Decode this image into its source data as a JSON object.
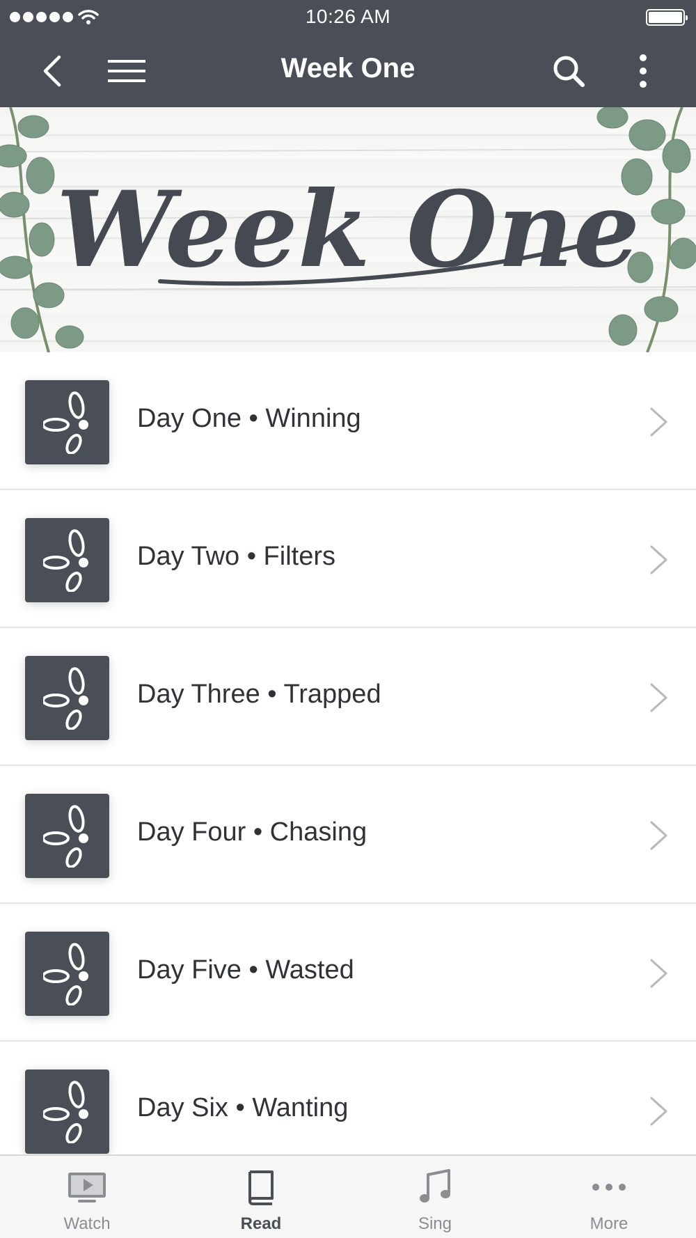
{
  "status_bar": {
    "time": "10:26 AM",
    "signal_icon": "signal-dots-icon",
    "wifi_icon": "wifi-icon",
    "battery_icon": "battery-icon",
    "battery_level": 1.0
  },
  "nav": {
    "title": "Week One",
    "back_icon": "chevron-left-icon",
    "menu_icon": "hamburger-menu-icon",
    "search_icon": "search-icon",
    "more_icon": "more-vertical-icon"
  },
  "banner": {
    "title_text": "Week One"
  },
  "list": {
    "items": [
      {
        "label": "Day One • Winning",
        "icon": "plan-logo-icon"
      },
      {
        "label": "Day Two • Filters",
        "icon": "plan-logo-icon"
      },
      {
        "label": "Day Three • Trapped",
        "icon": "plan-logo-icon"
      },
      {
        "label": "Day Four • Chasing",
        "icon": "plan-logo-icon"
      },
      {
        "label": "Day Five • Wasted",
        "icon": "plan-logo-icon"
      },
      {
        "label": "Day Six • Wanting",
        "icon": "plan-logo-icon"
      }
    ]
  },
  "tab_bar": {
    "active": "Read",
    "tabs": [
      {
        "label": "Watch",
        "icon": "tv-play-icon"
      },
      {
        "label": "Read",
        "icon": "book-icon"
      },
      {
        "label": "Sing",
        "icon": "music-note-icon"
      },
      {
        "label": "More",
        "icon": "more-horizontal-icon"
      }
    ]
  },
  "colors": {
    "header_bg": "#4a4e56",
    "text": "#2f3237",
    "tab_inactive": "#8a8d92",
    "divider": "#e6e6e6"
  }
}
